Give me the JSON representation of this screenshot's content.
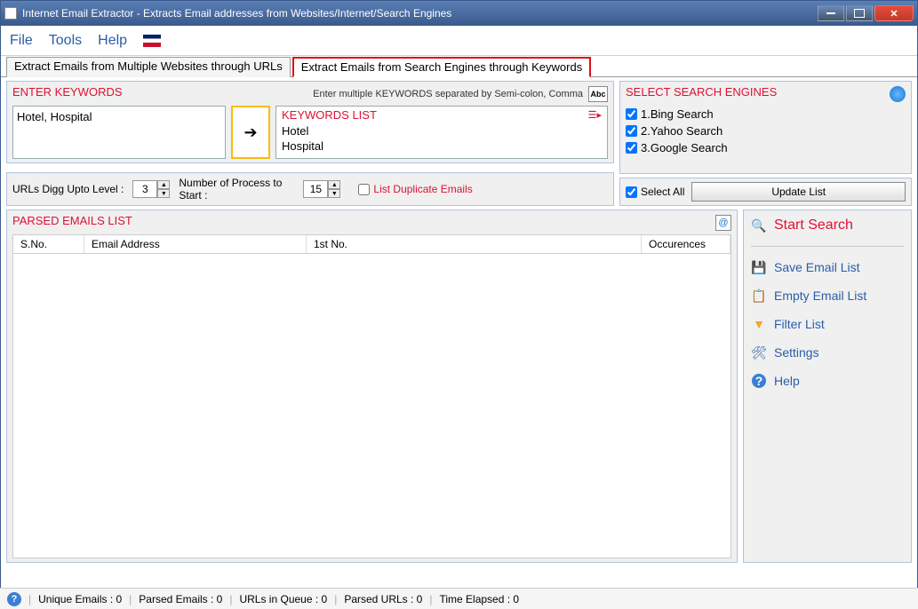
{
  "window_title": "Internet Email Extractor - Extracts Email addresses from Websites/Internet/Search Engines",
  "menu": {
    "file": "File",
    "tools": "Tools",
    "help": "Help"
  },
  "tabs": {
    "t1": "Extract Emails from Multiple Websites through URLs",
    "t2": "Extract Emails from Search Engines through Keywords"
  },
  "enter_keywords": {
    "header": "ENTER KEYWORDS",
    "hint": "Enter multiple KEYWORDS separated by Semi-colon, Comma",
    "abc": "Abc",
    "input_value": "Hotel, Hospital",
    "list_header": "KEYWORDS LIST",
    "items": [
      "Hotel",
      "Hospital"
    ]
  },
  "options": {
    "digg_label": "URLs Digg Upto Level :",
    "digg_value": "3",
    "proc_label": "Number of Process to Start :",
    "proc_value": "15",
    "dup_label": "List Duplicate Emails"
  },
  "engines": {
    "header": "SELECT SEARCH ENGINES",
    "items": [
      "1.Bing Search",
      "2.Yahoo Search",
      "3.Google Search"
    ],
    "select_all": "Select All",
    "update": "Update List"
  },
  "parsed": {
    "header": "PARSED EMAILS LIST",
    "cols": {
      "sno": "S.No.",
      "email": "Email Address",
      "first": "1st No.",
      "occ": "Occurences"
    }
  },
  "actions": {
    "start": "Start Search",
    "save": "Save Email List",
    "empty": "Empty Email List",
    "filter": "Filter List",
    "settings": "Settings",
    "help": "Help"
  },
  "status": {
    "unique": "Unique Emails :  0",
    "parsed": "Parsed Emails :  0",
    "queue": "URLs in Queue :  0",
    "purls": "Parsed URLs :  0",
    "time": "Time Elapsed :  0"
  }
}
